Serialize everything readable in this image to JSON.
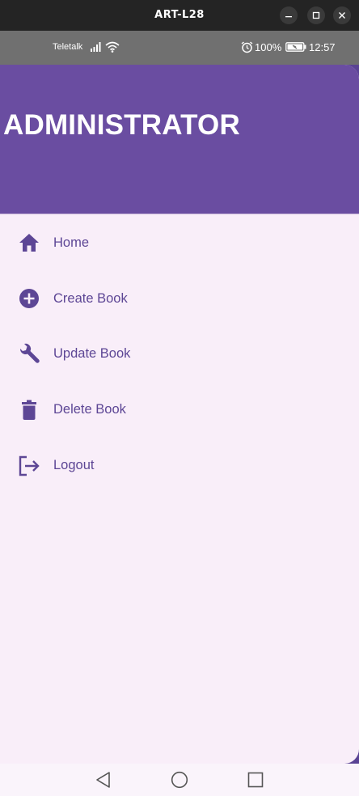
{
  "window": {
    "title": "ART-L28"
  },
  "status_bar": {
    "carrier": "Teletalk",
    "battery": "100%",
    "time": "12:57"
  },
  "drawer": {
    "heading": "ADMINISTRATOR",
    "items": [
      {
        "label": "Home",
        "icon": "home-icon"
      },
      {
        "label": "Create Book",
        "icon": "add-circle-icon"
      },
      {
        "label": "Update Book",
        "icon": "wrench-icon"
      },
      {
        "label": "Delete Book",
        "icon": "trash-icon"
      },
      {
        "label": "Logout",
        "icon": "logout-icon"
      }
    ]
  },
  "colors": {
    "header": "#6a4da1",
    "drawer_bg": "#f9eef9",
    "accent_text": "#5d4695"
  }
}
